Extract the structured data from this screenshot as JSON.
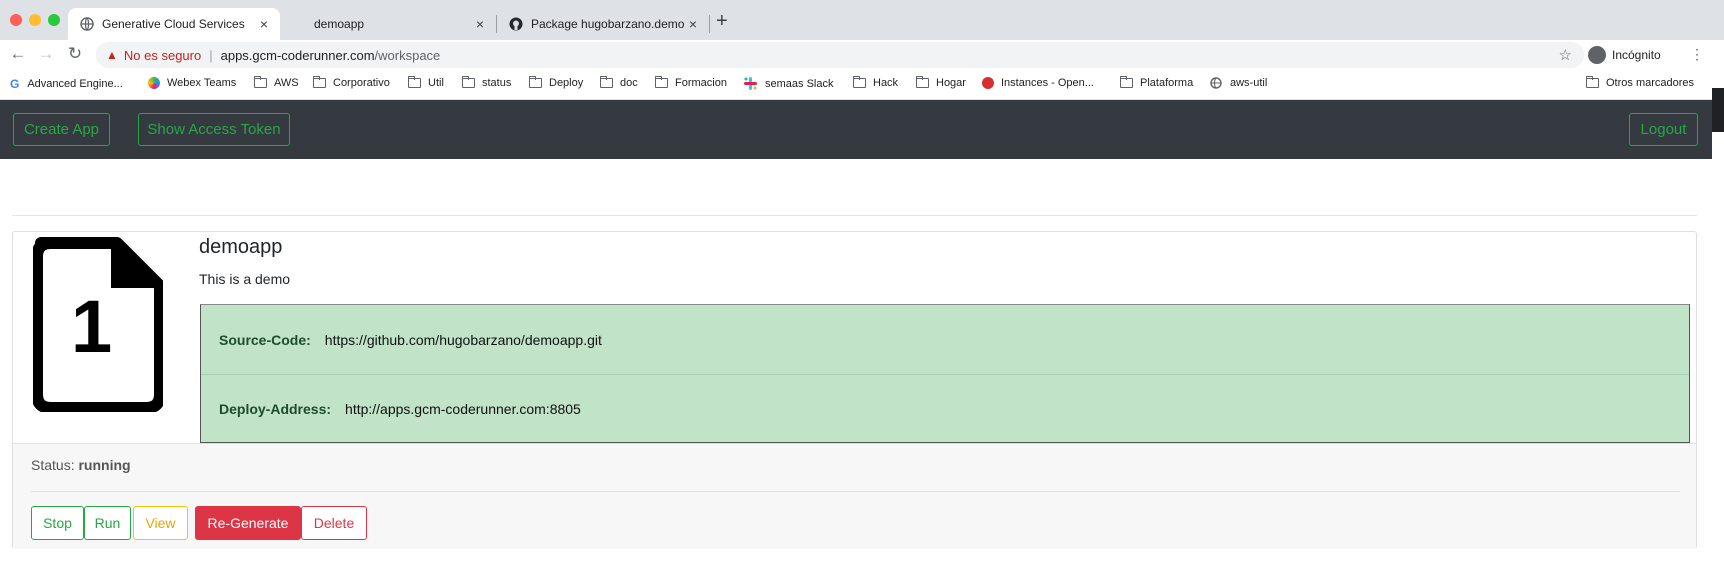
{
  "browser": {
    "tabs": [
      {
        "label": "Generative Cloud Services",
        "active": true
      },
      {
        "label": "demoapp",
        "active": false
      },
      {
        "label": "Package hugobarzano.demoap",
        "active": false
      }
    ],
    "close_glyph": "×",
    "newtab_glyph": "+",
    "address": {
      "warning_glyph": "▲",
      "insecure_label": "No es seguro",
      "separator": "|",
      "host": "apps.gcm-coderunner.com",
      "path": "/workspace"
    },
    "star_glyph": "☆",
    "back_glyph": "←",
    "forward_glyph": "→",
    "reload_glyph": "↻",
    "incognito_label": "Incógnito",
    "menu_glyph": "⋮",
    "bookmarks": [
      {
        "label": "Advanced Engine...",
        "icon": "google-icon"
      },
      {
        "label": "Webex Teams",
        "icon": "webex-icon"
      },
      {
        "label": "AWS",
        "icon": "folder-icon"
      },
      {
        "label": "Corporativo",
        "icon": "folder-icon"
      },
      {
        "label": "Util",
        "icon": "folder-icon"
      },
      {
        "label": "status",
        "icon": "folder-icon"
      },
      {
        "label": "Deploy",
        "icon": "folder-icon"
      },
      {
        "label": "doc",
        "icon": "folder-icon"
      },
      {
        "label": "Formacion",
        "icon": "folder-icon"
      },
      {
        "label": "semaas Slack",
        "icon": "slack-icon"
      },
      {
        "label": "Hack",
        "icon": "folder-icon"
      },
      {
        "label": "Hogar",
        "icon": "folder-icon"
      },
      {
        "label": "Instances - Open...",
        "icon": "openstack-icon"
      },
      {
        "label": "Plataforma",
        "icon": "folder-icon"
      },
      {
        "label": "aws-util",
        "icon": "globe-icon"
      }
    ],
    "other_bookmarks": "Otros marcadores",
    "google_letter": "G"
  },
  "navbar": {
    "create_app": "Create App",
    "show_token": "Show Access Token",
    "logout": "Logout"
  },
  "app": {
    "icon_number": "1",
    "name": "demoapp",
    "description": "This is a demo",
    "source_code_label": "Source-Code:",
    "source_code_value": "https://github.com/hugobarzano/demoapp.git",
    "deploy_address_label": "Deploy-Address:",
    "deploy_address_value": "http://apps.gcm-coderunner.com:8805",
    "status_label": "Status:",
    "status_value": "running",
    "actions": {
      "stop": "Stop",
      "run": "Run",
      "view": "View",
      "regenerate": "Re-Generate",
      "delete": "Delete"
    }
  },
  "colors": {
    "navbar_bg": "#343a40",
    "success": "#28a745",
    "warning": "#ffc107",
    "danger": "#dc3545",
    "info_table_bg": "#c1e3c7"
  }
}
